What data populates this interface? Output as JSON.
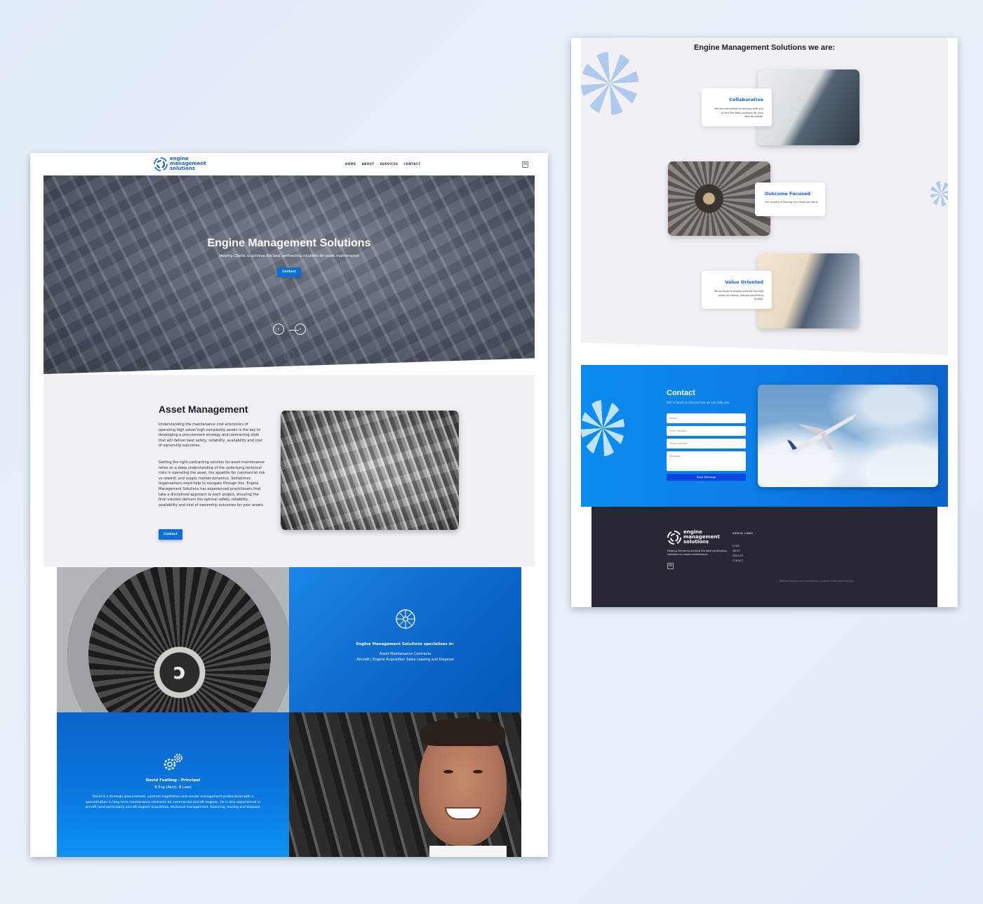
{
  "brand": {
    "logo_line1": "engine",
    "logo_line2": "management",
    "logo_line3": "solutions",
    "accent_color": "#0b6fd6"
  },
  "nav": {
    "items": [
      "HOME",
      "ABOUT",
      "SERVICES",
      "CONTACT"
    ],
    "social_icon": "linkedin-icon"
  },
  "hero": {
    "title": "Engine Management Solutions",
    "subtitle": "Helping Clients to achieve the best contracting solutions for asset maintenance",
    "button": "Contact",
    "prev_icon": "‹",
    "next_icon": "›",
    "scroll_icon": "⌄"
  },
  "asset": {
    "title": "Asset Management",
    "para1": "Understanding the maintenance cost economics of operating high value/ high complexity assets is the key to developing a procurement strategy and contracting style that will deliver best safety, reliability, availability and cost of ownership outcomes.",
    "para2": "Getting the right contracting solution for asset maintenance relies on a deep understanding of the underlying technical risks in operating the asset, the appetite for commercial risk vs reward, and supply market dynamics.  Sometimes organisations need help to navigate through this.  Engine Management Solutions has experienced practitioners that take a disciplined approach to each project, ensuring the final solution delivers the optimal safety, reliability, availability and cost of ownership outcomes for your assets.",
    "button": "Contact"
  },
  "specialises": {
    "heading": "Engine Management Solutions specialises in:",
    "line1": "Asset Maintenance Contracts",
    "line2": "Aircraft | Engine Acquisition Sales Leasing and Disposal"
  },
  "principal": {
    "name": "David Fuelling - Principal",
    "credentials": "B Eng (Aero), B Laws",
    "bio": "David is a strategic procurement, contract negotiation and vendor management professional with a specialisation in long term maintenance contracts for commercial aircraft engines. He is also experienced in aircraft (and particularly aircraft engine) acquisition, technical management, financing, leasing and disposal."
  },
  "values": {
    "title": "Engine Management Solutions we are:",
    "cards": [
      {
        "title": "Collaborative",
        "text": "We are committed to working with you to find the best solutions for your specific needs."
      },
      {
        "title": "Outcome Focused",
        "text": "Our priority is helping you reach solutions."
      },
      {
        "title": "Value Oriented",
        "text": "We promise to always provide the best value for money, without sacrificing quality."
      }
    ]
  },
  "contact": {
    "title": "Contact",
    "subtitle": "Get in touch to discuss how we can help you",
    "name_placeholder": "Name",
    "email_placeholder": "Email Address",
    "phone_placeholder": "Phone Number",
    "message_placeholder": "Message",
    "send_button": "Send Message"
  },
  "footer": {
    "tagline": "Helping Clients to achieve the best contracting solutions for asset maintenance",
    "links_heading": "USEFUL LINKS",
    "links": [
      "HOME",
      "ABOUT",
      "SERVICES",
      "CONTACT"
    ],
    "credit": "Website designed and managed by Jonathan Brokenwood Designs"
  }
}
